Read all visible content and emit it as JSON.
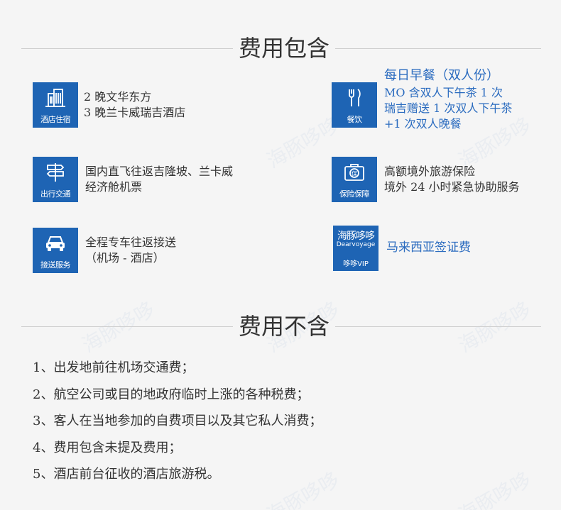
{
  "included": {
    "title": "费用包含",
    "items": [
      {
        "icon": "hotel-icon",
        "icon_label": "酒店住宿",
        "lines": [
          "2 晚文华东方",
          "3 晚兰卡威瑞吉酒店"
        ]
      },
      {
        "icon": "dining-icon",
        "icon_label": "餐饮",
        "heading": "每日早餐（双人份）",
        "lines": [
          "MO 含双人下午茶 1 次",
          "瑞吉赠送 1 次双人下午茶",
          "+1 次双人晚餐"
        ]
      },
      {
        "icon": "signpost-icon",
        "icon_label": "出行交通",
        "lines": [
          "国内直飞往返吉隆坡、兰卡威",
          "经济舱机票"
        ]
      },
      {
        "icon": "insurance-icon",
        "icon_label": "保险保障",
        "lines": [
          "高额境外旅游保险",
          "境外 24 小时紧急协助服务"
        ]
      },
      {
        "icon": "car-icon",
        "icon_label": "接送服务",
        "lines": [
          "全程专车往返接送",
          "（机场 - 酒店）"
        ]
      },
      {
        "icon": "brand-logo",
        "brand_cn": "海豚哆哆",
        "brand_en": "Dearvoyage",
        "icon_label": "哆哆VIP",
        "lines": [
          "马来西亚签证费"
        ]
      }
    ]
  },
  "excluded": {
    "title": "费用不含",
    "items": [
      "1、出发地前往机场交通费；",
      "2、航空公司或目的地政府临时上涨的各种税费；",
      "3、客人在当地参加的自费项目以及其它私人消费；",
      "4、费用包含未提及费用；",
      "5、酒店前台征收的酒店旅游税。"
    ]
  },
  "colors": {
    "accent": "#1e64b4",
    "highlight_text": "#2a6bbf",
    "background": "#f5f5f5"
  }
}
